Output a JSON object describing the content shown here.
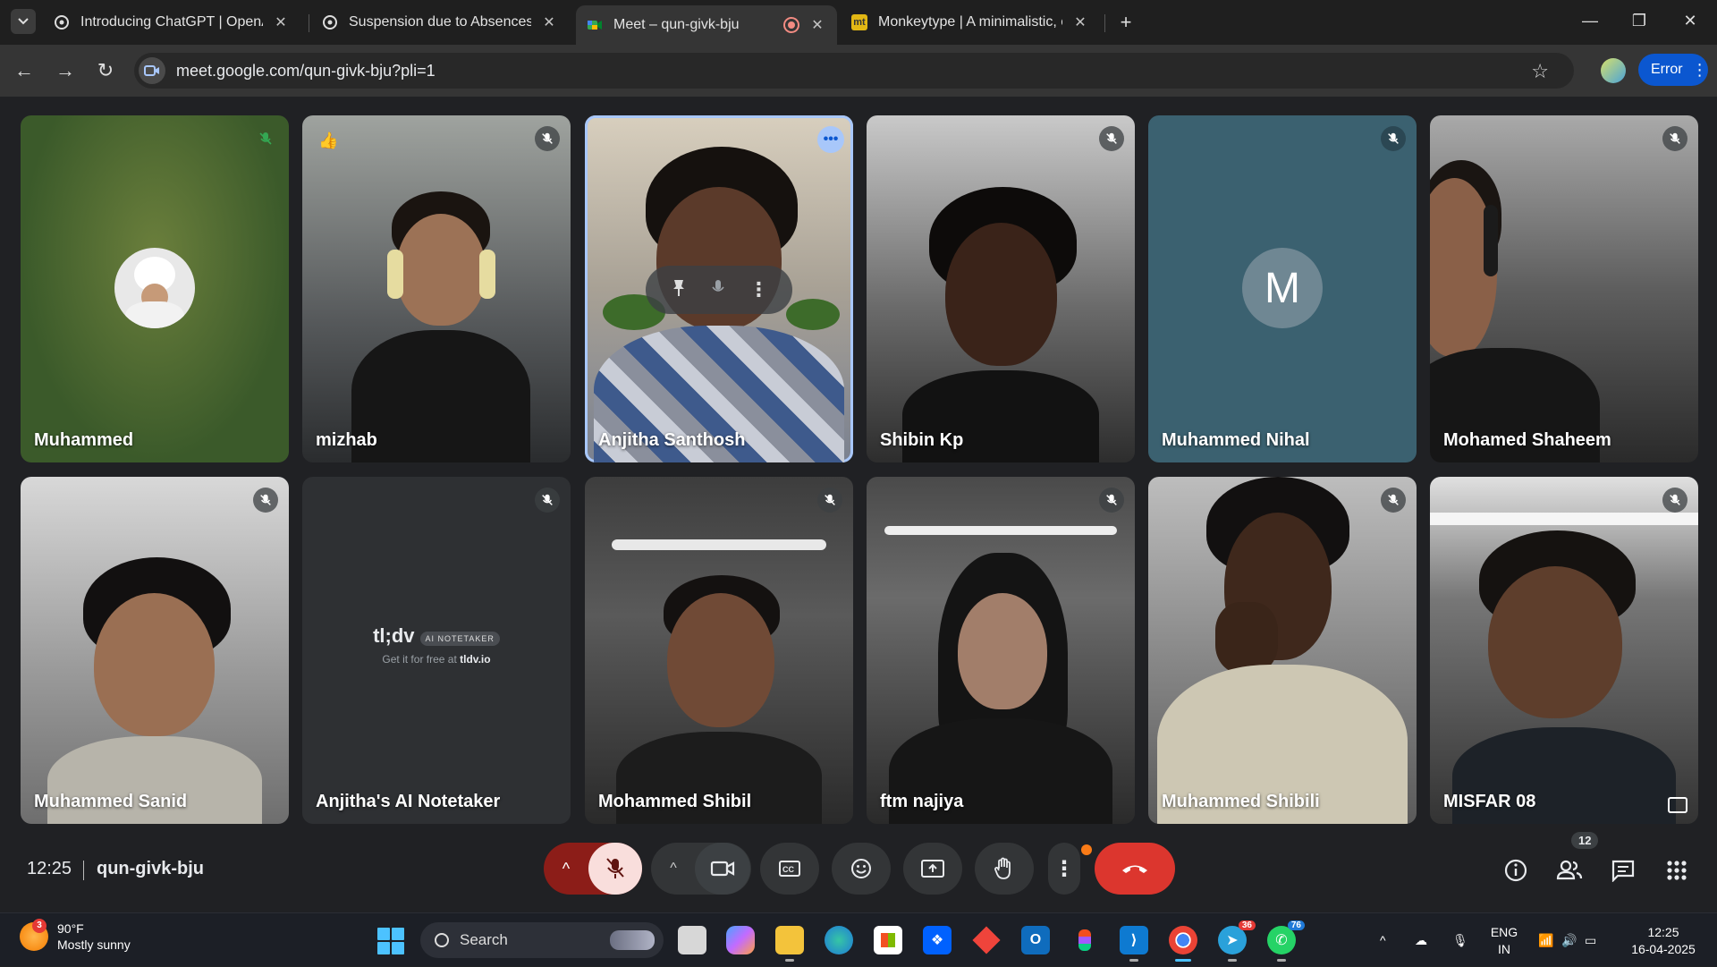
{
  "browser": {
    "tabs": [
      {
        "title": "Introducing ChatGPT | OpenAI",
        "favicon": "openai-icon"
      },
      {
        "title": "Suspension due to Absences",
        "favicon": "openai-icon"
      },
      {
        "title": "Meet – qun-givk-bju",
        "favicon": "google-meet-icon",
        "active": true
      },
      {
        "title": "Monkeytype | A minimalistic, cu",
        "favicon_text": "mt"
      }
    ],
    "url": "meet.google.com/qun-givk-bju?pli=1",
    "error_label": "Error"
  },
  "meet": {
    "participants": [
      {
        "name": "Muhammed",
        "muted": true,
        "speaking_indicator": "green"
      },
      {
        "name": "mizhab",
        "muted": true,
        "reaction": "👍"
      },
      {
        "name": "Anjitha Santhosh",
        "muted": false,
        "active": true
      },
      {
        "name": "Shibin Kp",
        "muted": true
      },
      {
        "name": "Muhammed Nihal",
        "muted": true,
        "initial": "M"
      },
      {
        "name": "Mohamed Shaheem",
        "muted": true
      },
      {
        "name": "Muhammed Sanid",
        "muted": true
      },
      {
        "name": "Anjitha's AI Notetaker",
        "muted": true
      },
      {
        "name": "Mohammed Shibil",
        "muted": true
      },
      {
        "name": "ftm najiya",
        "muted": true
      },
      {
        "name": "Muhammed Shibili",
        "muted": true
      },
      {
        "name": "MISFAR 08",
        "muted": true
      }
    ],
    "tldv": {
      "logo": "tl;dv",
      "badge": "AI NOTETAKER",
      "sub_prefix": "Get it for free at ",
      "sub_link": "tldv.io"
    },
    "time": "12:25",
    "meeting_code": "qun-givk-bju",
    "people_count": "12"
  },
  "taskbar": {
    "weather_temp": "90°F",
    "weather_desc": "Mostly sunny",
    "weather_badge": "3",
    "search_label": "Search",
    "telegram_badge": "36",
    "whatsapp_badge": "76",
    "lang_top": "ENG",
    "lang_bottom": "IN",
    "clock_time": "12:25",
    "clock_date": "16-04-2025"
  },
  "colors": {
    "accent": "#a8c7fa",
    "end_call": "#dc362e",
    "muted_mic_bg": "#f9dedc"
  }
}
